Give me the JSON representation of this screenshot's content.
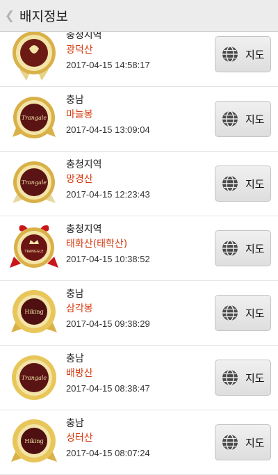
{
  "header": {
    "back_icon": "chevron-left-icon",
    "title": "배지정보"
  },
  "button_label": "지도",
  "items": [
    {
      "region": "충청지역",
      "name": "광덕산",
      "date": "2017-04-15 14:58:17",
      "badge_text": ""
    },
    {
      "region": "충남",
      "name": "마늘봉",
      "date": "2017-04-15 13:09:04",
      "badge_text": "Trangale"
    },
    {
      "region": "충청지역",
      "name": "망경산",
      "date": "2017-04-15 12:23:43",
      "badge_text": "Trangale"
    },
    {
      "region": "충청지역",
      "name": "태화산(태학산)",
      "date": "2017-04-15 10:38:52",
      "badge_text": "TRANGGLE"
    },
    {
      "region": "충남",
      "name": "삼각봉",
      "date": "2017-04-15 09:38:29",
      "badge_text": "Hiking"
    },
    {
      "region": "충남",
      "name": "배방산",
      "date": "2017-04-15 08:38:47",
      "badge_text": "Trangale"
    },
    {
      "region": "충남",
      "name": "성터산",
      "date": "2017-04-15 08:07:24",
      "badge_text": "Hiking"
    }
  ],
  "colors": {
    "mountain_name": "#d43a0e",
    "badge_gold": "#d9b148",
    "badge_center": "#5a1414",
    "ribbon_red": "#c8161a"
  }
}
